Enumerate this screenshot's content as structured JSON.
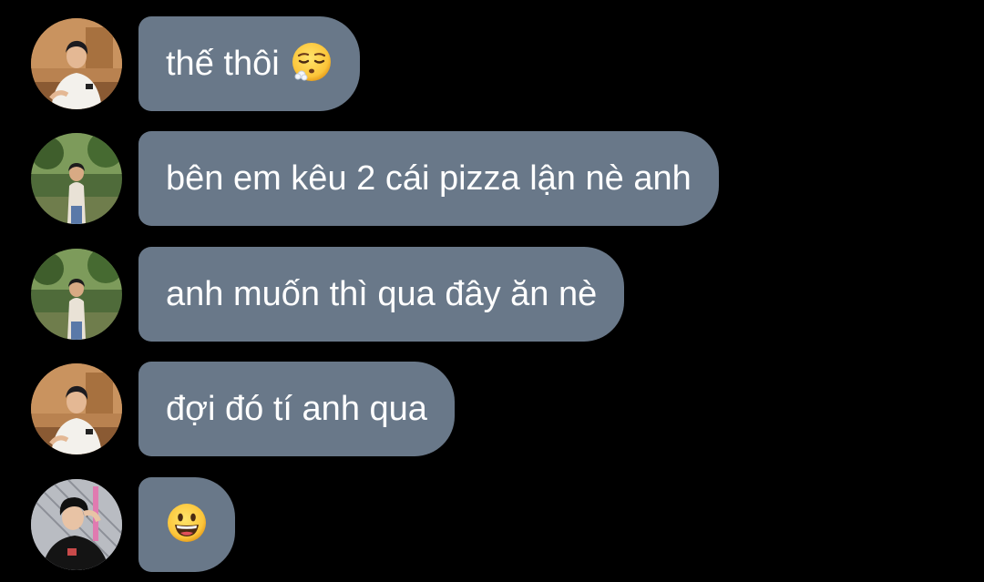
{
  "chat": {
    "background": "#000000",
    "bubble_color": "#697889",
    "text_color": "#ffffff",
    "messages": [
      {
        "text": "thế thôi",
        "emoji": "relieved-sleepy-face-emoji",
        "avatar": "avatar-white-shirt-warm"
      },
      {
        "text": "bên em kêu 2 cái pizza lận nè anh",
        "emoji": "",
        "avatar": "avatar-outdoor-green"
      },
      {
        "text": "anh muốn thì qua đây ăn nè",
        "emoji": "",
        "avatar": "avatar-outdoor-green"
      },
      {
        "text": "đợi đó tí anh qua",
        "emoji": "",
        "avatar": "avatar-white-shirt-warm"
      },
      {
        "text": "",
        "emoji": "grinning-face-emoji",
        "avatar": "avatar-dark-shirt"
      }
    ]
  }
}
